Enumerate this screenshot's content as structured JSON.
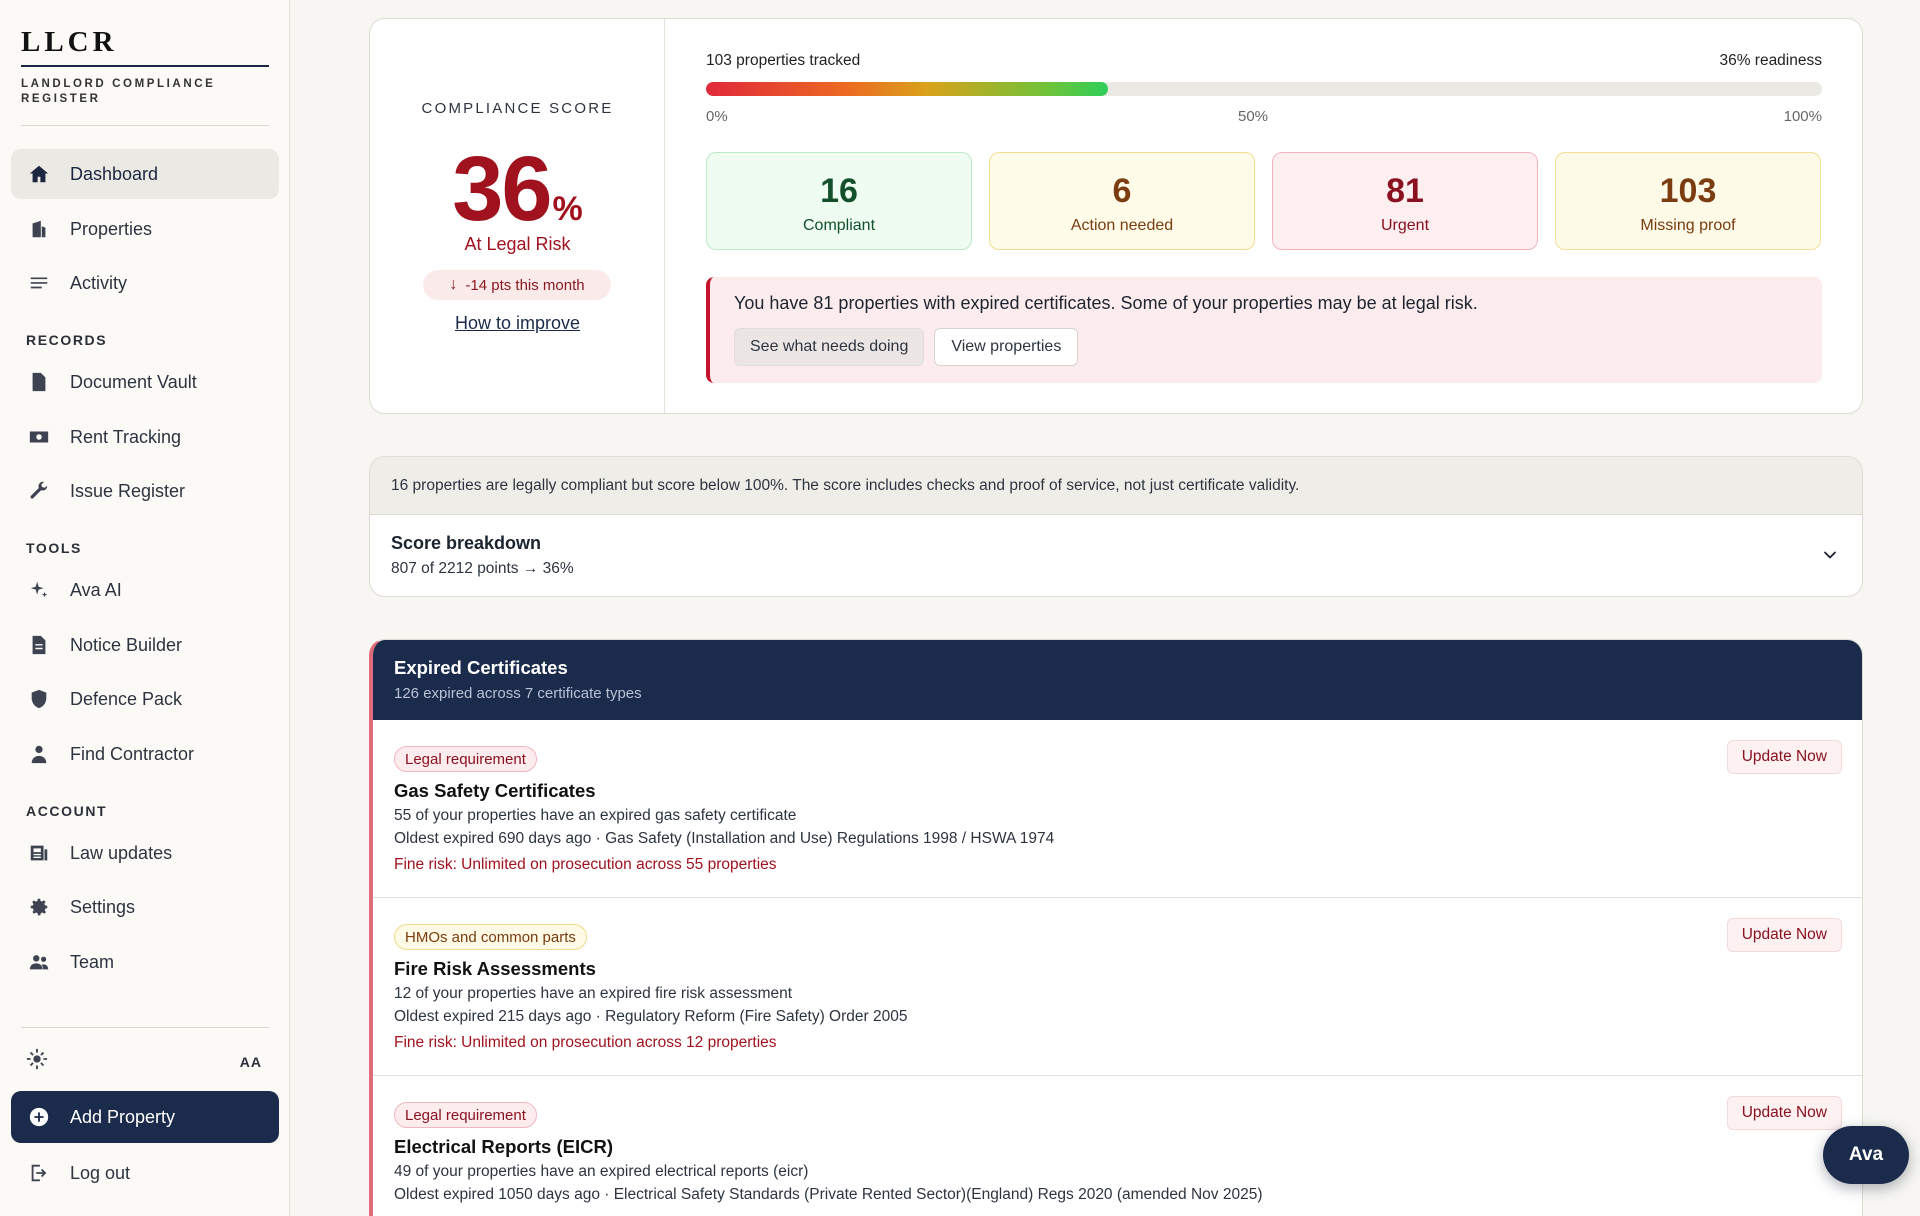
{
  "brand": {
    "title": "LLCR",
    "subtitle": "LANDLORD COMPLIANCE REGISTER"
  },
  "sidebar": {
    "main": [
      {
        "label": "Dashboard",
        "icon": "home-icon",
        "active": true
      },
      {
        "label": "Properties",
        "icon": "building-icon"
      },
      {
        "label": "Activity",
        "icon": "list-icon"
      }
    ],
    "records_label": "RECORDS",
    "records": [
      {
        "label": "Document Vault",
        "icon": "document-icon"
      },
      {
        "label": "Rent Tracking",
        "icon": "cash-icon"
      },
      {
        "label": "Issue Register",
        "icon": "wrench-icon"
      }
    ],
    "tools_label": "TOOLS",
    "tools": [
      {
        "label": "Ava AI",
        "icon": "sparkle-icon"
      },
      {
        "label": "Notice Builder",
        "icon": "file-text-icon"
      },
      {
        "label": "Defence Pack",
        "icon": "shield-icon"
      },
      {
        "label": "Find Contractor",
        "icon": "person-icon"
      }
    ],
    "account_label": "ACCOUNT",
    "account": [
      {
        "label": "Law updates",
        "icon": "newspaper-icon"
      },
      {
        "label": "Settings",
        "icon": "gear-icon"
      },
      {
        "label": "Team",
        "icon": "team-icon"
      }
    ],
    "font_size_label": "AA",
    "add_property": "Add Property",
    "logout": "Log out"
  },
  "score": {
    "label": "COMPLIANCE SCORE",
    "value": "36",
    "unit": "%",
    "status": "At Legal Risk",
    "change": "-14 pts this month",
    "how_link": "How to improve"
  },
  "progress": {
    "tracked": "103 properties tracked",
    "readiness": "36% readiness",
    "fill_fraction": 0.36,
    "ticks": [
      "0%",
      "50%",
      "100%"
    ]
  },
  "stats": [
    {
      "value": "16",
      "label": "Compliant",
      "tone": "green"
    },
    {
      "value": "6",
      "label": "Action needed",
      "tone": "amber"
    },
    {
      "value": "81",
      "label": "Urgent",
      "tone": "red"
    },
    {
      "value": "103",
      "label": "Missing proof",
      "tone": "yellow"
    }
  ],
  "alert": {
    "message": "You have 81 properties with expired certificates. Some of your properties may be at legal risk.",
    "btn_primary": "See what needs doing",
    "btn_secondary": "View properties"
  },
  "info": {
    "note": "16 properties are legally compliant but score below 100%. The score includes checks and proof of service, not just certificate validity.",
    "breakdown_title": "Score breakdown",
    "breakdown_detail": "807 of 2212 points → 36%"
  },
  "expired": {
    "title": "Expired Certificates",
    "subtitle": "126 expired across 7 certificate types",
    "update_label": "Update Now",
    "items": [
      {
        "chip": "Legal requirement",
        "chip_tone": "legal",
        "title": "Gas Safety Certificates",
        "desc": "55 of your properties have an expired gas safety certificate",
        "meta": "Oldest expired 690 days ago · Gas Safety (Installation and Use) Regulations 1998 / HSWA 1974",
        "fine": "Fine risk: Unlimited on prosecution across 55 properties"
      },
      {
        "chip": "HMOs and common parts",
        "chip_tone": "hmo",
        "title": "Fire Risk Assessments",
        "desc": "12 of your properties have an expired fire risk assessment",
        "meta": "Oldest expired 215 days ago · Regulatory Reform (Fire Safety) Order 2005",
        "fine": "Fine risk: Unlimited on prosecution across 12 properties"
      },
      {
        "chip": "Legal requirement",
        "chip_tone": "legal",
        "title": "Electrical Reports (EICR)",
        "desc": "49 of your properties have an expired electrical reports (eicr)",
        "meta": "Oldest expired 1050 days ago · Electrical Safety Standards (Private Rented Sector)(England) Regs 2020 (amended Nov 2025)",
        "fine": ""
      }
    ]
  },
  "ava_fab": "Ava",
  "colors": {
    "navy": "#1b2b4b",
    "danger": "#a0121e",
    "background": "#f7f6f2"
  }
}
